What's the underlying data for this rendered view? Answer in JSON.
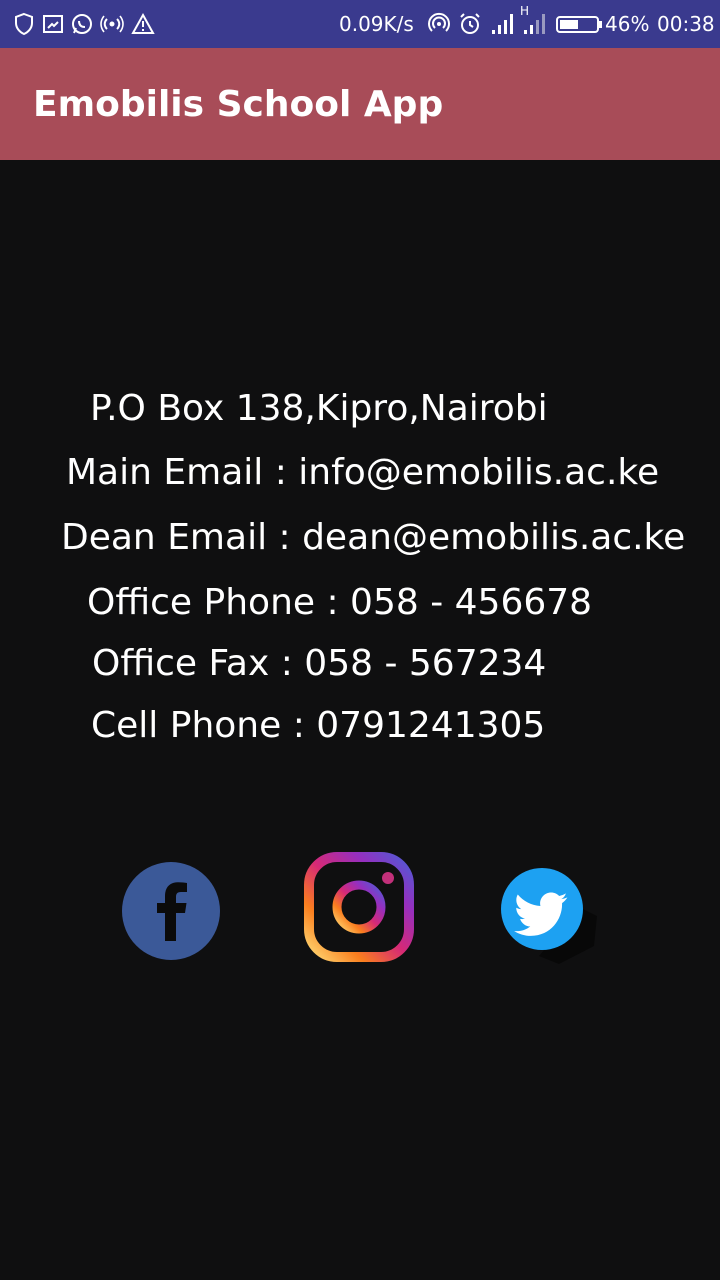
{
  "status_bar": {
    "net_speed": "0.09K/s",
    "signal_h": "H",
    "battery": "46%",
    "time": "00:38",
    "icons": [
      "shield-icon",
      "cast-icon",
      "whatsapp-icon",
      "hotspot-icon",
      "warning-icon",
      "broadcast-icon",
      "alarm-icon",
      "signal-icon",
      "signal-icon",
      "battery-icon"
    ]
  },
  "app_bar": {
    "title": "Emobilis School App",
    "color": "#a84c58"
  },
  "contact": {
    "address": "P.O Box 138,Kipro,Nairobi",
    "main_email": "Main Email : info@emobilis.ac.ke",
    "dean_email": "Dean Email : dean@emobilis.ac.ke",
    "office_phone": "Office Phone : 058 - 456678",
    "office_fax": "Office Fax : 058 - 567234",
    "cell_phone": "Cell Phone : 0791241305"
  },
  "social": [
    {
      "name": "facebook",
      "icon": "facebook-icon",
      "color": "#3b5998"
    },
    {
      "name": "instagram",
      "icon": "instagram-icon",
      "color": "#e1306c"
    },
    {
      "name": "twitter",
      "icon": "twitter-icon",
      "color": "#1da1f2"
    }
  ]
}
